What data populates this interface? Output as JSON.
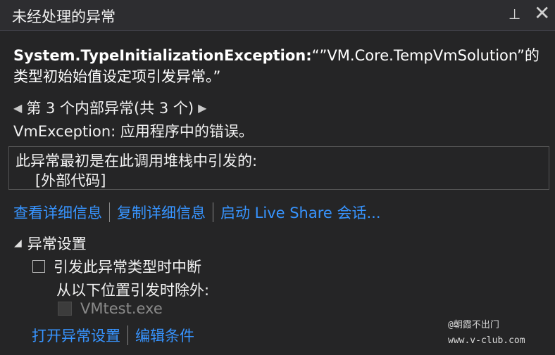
{
  "window": {
    "title": "未经处理的异常"
  },
  "exception": {
    "type": "System.TypeInitializationException:",
    "message": "“”VM.Core.TempVmSolution”的类型初始始值设定项引发异常。”"
  },
  "inner_nav": {
    "label": "第 3 个内部异常(共 3 个)"
  },
  "inner_exception": "VmException: 应用程序中的错误。",
  "stack": {
    "title": "此异常最初是在此调用堆栈中引发的:",
    "frames": [
      "[外部代码]"
    ]
  },
  "links": {
    "view_details": "查看详细信息",
    "copy_details": "复制详细信息",
    "live_share": "启动 Live Share 会话..."
  },
  "settings": {
    "header": "异常设置",
    "break_when": "引发此异常类型时中断",
    "except_label": "从以下位置引发时除外:",
    "except_item": "VMtest.exe",
    "open_settings": "打开异常设置",
    "edit_conditions": "编辑条件"
  },
  "watermark": {
    "line1": "@朝霞不出门",
    "line2": "www.v-club.com"
  },
  "colors": {
    "background": "#252526",
    "link": "#3794ff"
  }
}
